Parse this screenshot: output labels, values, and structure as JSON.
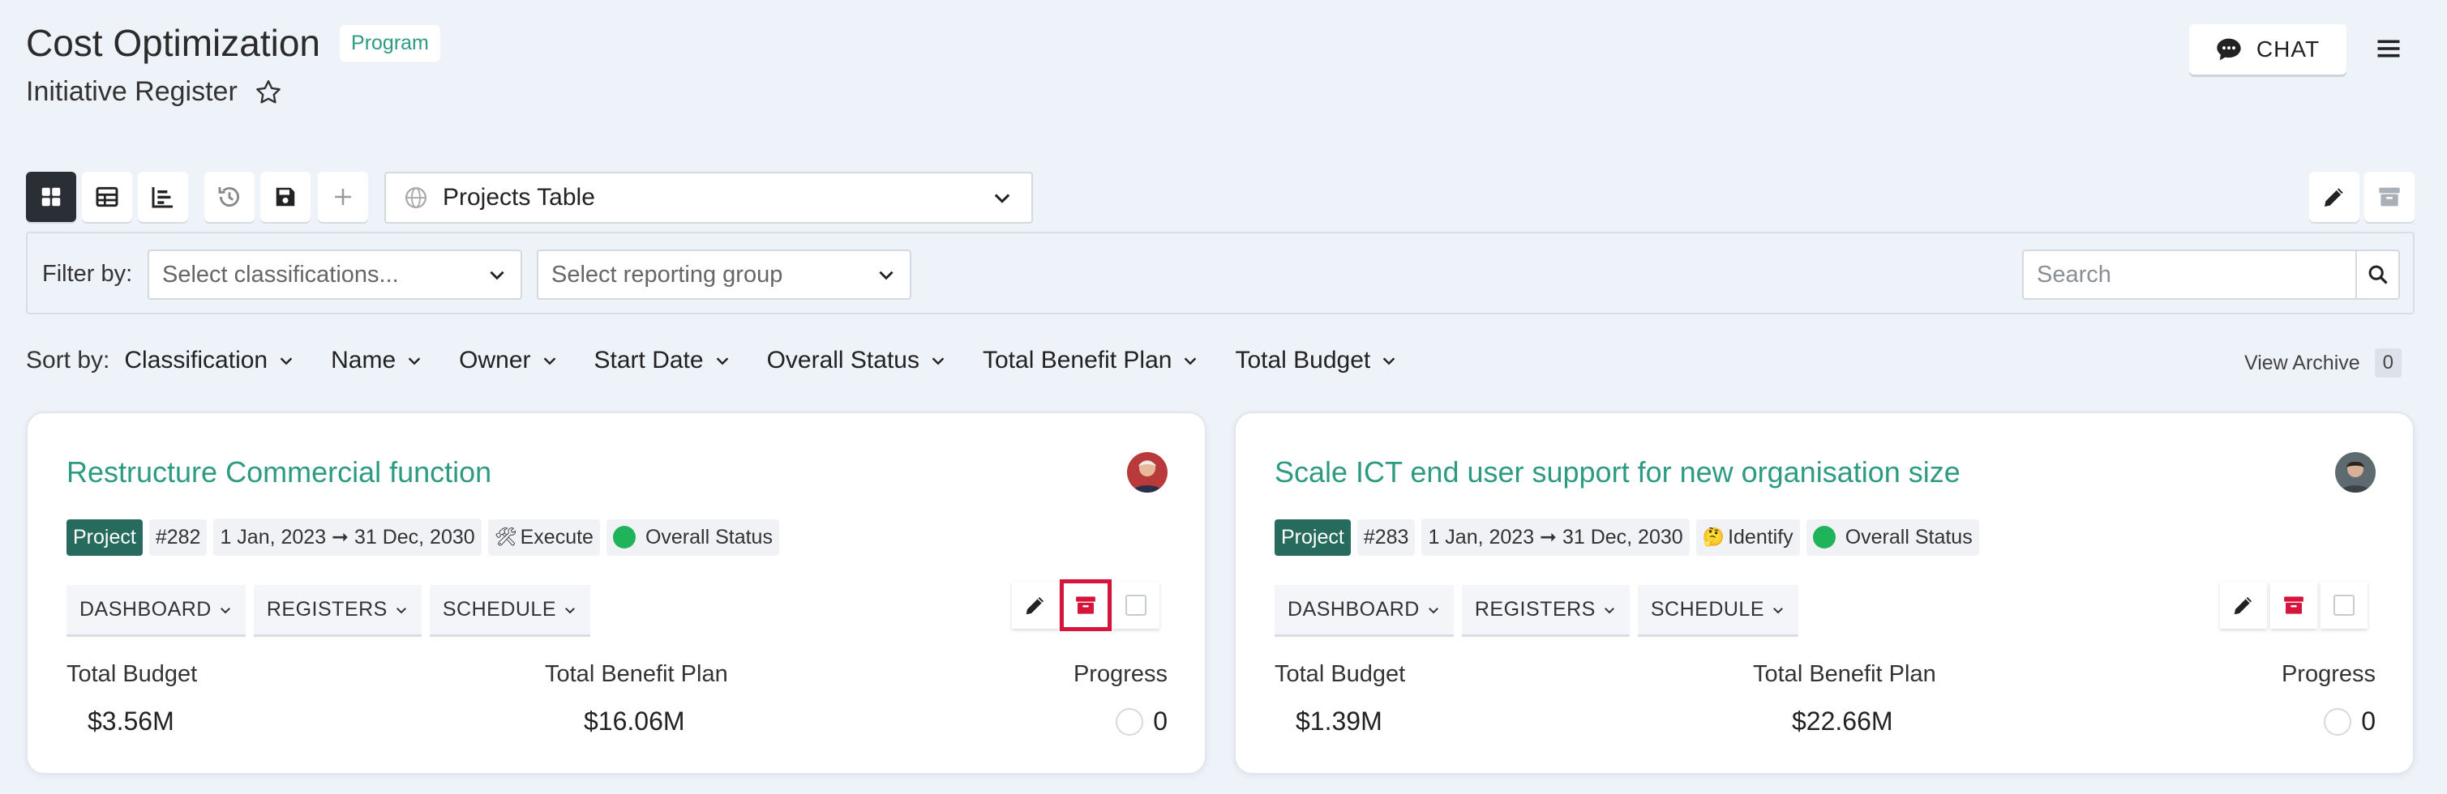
{
  "header": {
    "title": "Cost Optimization",
    "badge": "Program",
    "subtitle": "Initiative Register",
    "chat_label": "CHAT"
  },
  "toolbar": {
    "view_selected": "Projects Table"
  },
  "filter": {
    "label": "Filter by:",
    "classifications_placeholder": "Select classifications...",
    "reporting_placeholder": "Select reporting group",
    "search_placeholder": "Search"
  },
  "sort": {
    "label": "Sort by:",
    "items": [
      "Classification",
      "Name",
      "Owner",
      "Start Date",
      "Overall Status",
      "Total Benefit Plan",
      "Total Budget"
    ]
  },
  "archive": {
    "label": "View Archive",
    "count": "0"
  },
  "cards": [
    {
      "title": "Restructure Commercial function",
      "type": "Project",
      "id": "#282",
      "dates": "1 Jan, 2023 ➞ 31 Dec, 2030",
      "phase_icon": "🛠",
      "phase": "Execute",
      "status": "Overall Status",
      "status_color": "#1fb35a",
      "tabs": [
        "DASHBOARD",
        "REGISTERS",
        "SCHEDULE"
      ],
      "budget_label": "Total Budget",
      "budget": "$3.56M",
      "benefit_label": "Total Benefit Plan",
      "benefit": "$16.06M",
      "progress_label": "Progress",
      "progress": "0"
    },
    {
      "title": "Scale ICT end user support for new organisation size",
      "type": "Project",
      "id": "#283",
      "dates": "1 Jan, 2023 ➞ 31 Dec, 2030",
      "phase_icon": "🤔",
      "phase": "Identify",
      "status": "Overall Status",
      "status_color": "#1fb35a",
      "tabs": [
        "DASHBOARD",
        "REGISTERS",
        "SCHEDULE"
      ],
      "budget_label": "Total Budget",
      "budget": "$1.39M",
      "benefit_label": "Total Benefit Plan",
      "benefit": "$22.66M",
      "progress_label": "Progress",
      "progress": "0"
    }
  ],
  "colors": {
    "accent": "#2c9b82",
    "archive_red": "#d6143c",
    "project_tag": "#276b5e"
  }
}
